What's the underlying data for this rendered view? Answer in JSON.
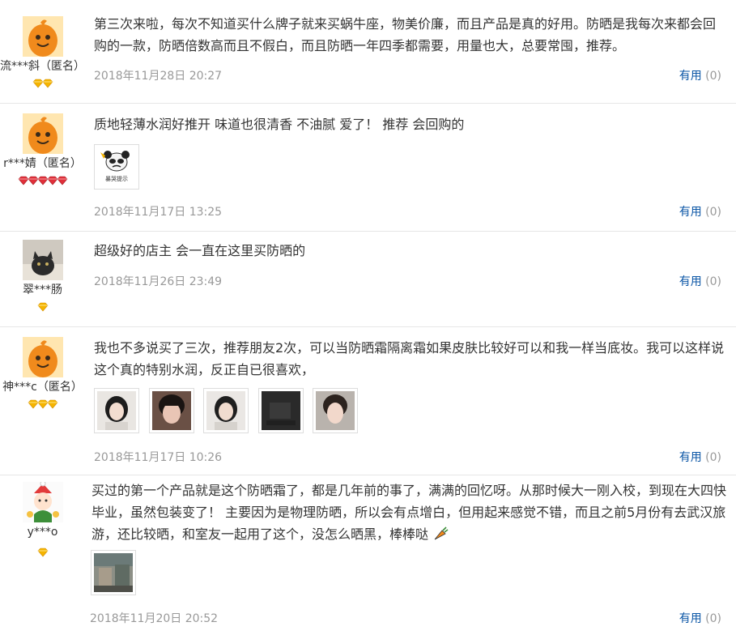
{
  "reviews": [
    {
      "username": "流***斜（匿名）",
      "content": "第三次来啦，每次不知道买什么牌子就来买蜗牛座，物美价廉，而且产品是真的好用。防晒是我每次来都会回购的一款，防晒倍数高而且不假白，而且防晒一年四季都需要，用量也大，总要常囤，推荐。",
      "date": "2018年11月28日 20:27",
      "useful_label": "有用",
      "useful_count": "(0)"
    },
    {
      "username": "r***婧（匿名）",
      "content": "质地轻薄水润好推开 味道也很清香 不油腻 爱了！ 推荐 会回购的",
      "photo_caption": "暴哭提示",
      "date": "2018年11月17日 13:25",
      "useful_label": "有用",
      "useful_count": "(0)"
    },
    {
      "username": "翠***肠",
      "content": "超级好的店主 会一直在这里买防晒的",
      "date": "2018年11月26日 23:49",
      "useful_label": "有用",
      "useful_count": "(0)"
    },
    {
      "username": "神***c（匿名）",
      "content": "我也不多说买了三次，推荐朋友2次，可以当防晒霜隔离霜如果皮肤比较好可以和我一样当底妆。我可以这样说这个真的特别水润，反正自已很喜欢，",
      "date": "2018年11月17日 10:26",
      "useful_label": "有用",
      "useful_count": "(0)"
    },
    {
      "username": "y***o",
      "content": "买过的第一个产品就是这个防晒霜了，都是几年前的事了，满满的回忆呀。从那时候大一刚入校，到现在大四快毕业，虽然包装变了！ 主要因为是物理防晒，所以会有点增白，但用起来感觉不错，而且之前5月份有去武汉旅游，还比较晒，和室友一起用了这个，没怎么晒黑，棒棒哒",
      "date": "2018年11月20日 20:52",
      "useful_label": "有用",
      "useful_count": "(0)"
    }
  ],
  "colors": {
    "avatar_orange": "#f08a1c",
    "useful_link": "#0b56a6",
    "date_gray": "#999999",
    "badge_gold": "#f5b400",
    "badge_red": "#e0303a"
  }
}
